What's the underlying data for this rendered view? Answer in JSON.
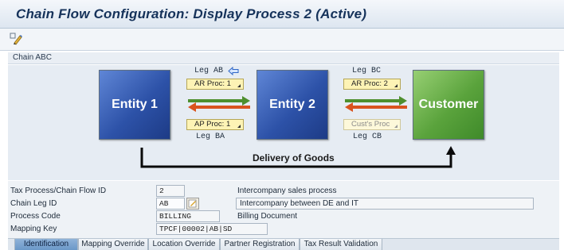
{
  "title": "Chain Flow Configuration: Display Process 2 (Active)",
  "toolbar": {
    "icons": [
      "display-change-icon"
    ]
  },
  "section": {
    "label": "Chain ABC"
  },
  "diagram": {
    "entities": [
      "Entity 1",
      "Entity 2",
      "Customer"
    ],
    "legs_top": [
      "Leg AB",
      "Leg BC"
    ],
    "legs_bottom": [
      "Leg BA",
      "Leg CB"
    ],
    "procs_top": [
      "AR Proc: 1",
      "AR Proc: 2"
    ],
    "procs_bottom": [
      "AP Proc: 1",
      "Cust's Proc"
    ],
    "delivery_label": "Delivery of Goods",
    "colors": {
      "entity_blue": "#2d52a8",
      "entity_green": "#5aa33c",
      "flow_green": "#4e8f2e",
      "flow_orange": "#d9531e"
    }
  },
  "form": {
    "rows": [
      {
        "label": "Tax Process/Chain Flow ID",
        "value": "2",
        "description": "Intercompany sales process"
      },
      {
        "label": "Chain Leg ID",
        "value": "AB",
        "description": "Intercompany between DE and IT"
      },
      {
        "label": "Process Code",
        "value": "BILLING",
        "description": "Billing Document"
      },
      {
        "label": "Mapping Key",
        "value": "TPCF|00002|AB|SD",
        "description": ""
      }
    ]
  },
  "tabs": [
    "Identification",
    "Mapping Override",
    "Location Override",
    "Partner Registration",
    "Tax Result Validation"
  ]
}
